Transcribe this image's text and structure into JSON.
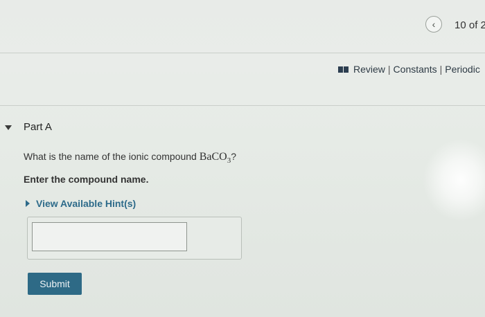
{
  "header": {
    "back_icon_glyph": "‹",
    "pager_text": "10 of 2"
  },
  "links": {
    "icon": "book-icon",
    "review": "Review",
    "separator": "|",
    "constants": "Constants",
    "periodic": "Periodic"
  },
  "part": {
    "title": "Part A"
  },
  "question": {
    "prefix": "What is the name of the ionic compound ",
    "formula_main": "BaCO",
    "formula_sub": "3",
    "suffix": "?"
  },
  "instruction": "Enter the compound name.",
  "hint": {
    "label": "View Available Hint(s)"
  },
  "answer": {
    "value": "",
    "placeholder": ""
  },
  "submit": {
    "label": "Submit"
  },
  "colors": {
    "accent": "#2e6a86",
    "link": "#2d6a8a"
  }
}
